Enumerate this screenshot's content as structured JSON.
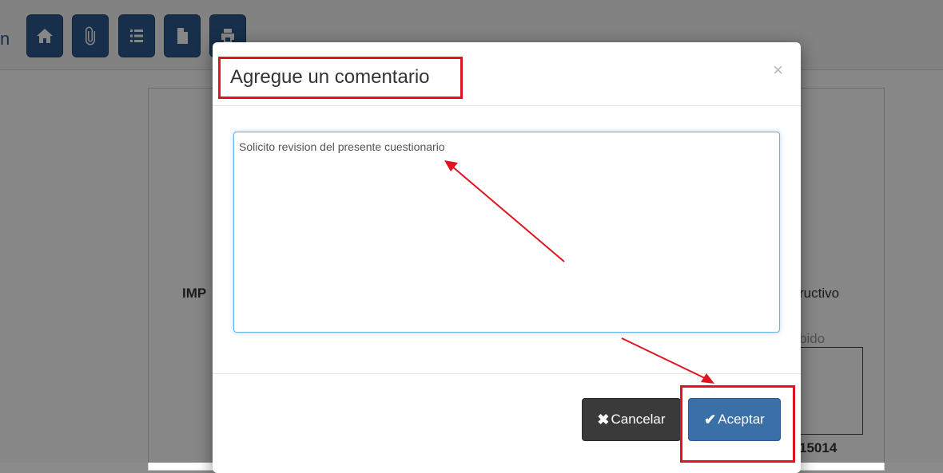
{
  "toolbar": {
    "buttons": [
      {
        "icon": "home-icon"
      },
      {
        "icon": "paperclip-icon"
      },
      {
        "icon": "list-icon"
      },
      {
        "icon": "file-icon"
      },
      {
        "icon": "print-icon"
      }
    ]
  },
  "background": {
    "edge_glyph": "n",
    "left_fragment": "IMP",
    "right_fragment_1": "ructivo",
    "right_fragment_2": "bido",
    "right_fragment_3": "15014"
  },
  "modal": {
    "title": "Agregue un comentario",
    "close_label": "×",
    "textarea_value": "Solicito revision del presente cuestionario",
    "cancel_label": "Cancelar",
    "accept_label": "Aceptar",
    "cancel_glyph": "✖",
    "accept_glyph": "✔"
  },
  "colors": {
    "toolbar_button": "#2d5a8e",
    "accept_button": "#3b6fa7",
    "cancel_button": "#3a3a3a",
    "annotation_red": "#e0141e",
    "textarea_focus": "#66afe9"
  }
}
